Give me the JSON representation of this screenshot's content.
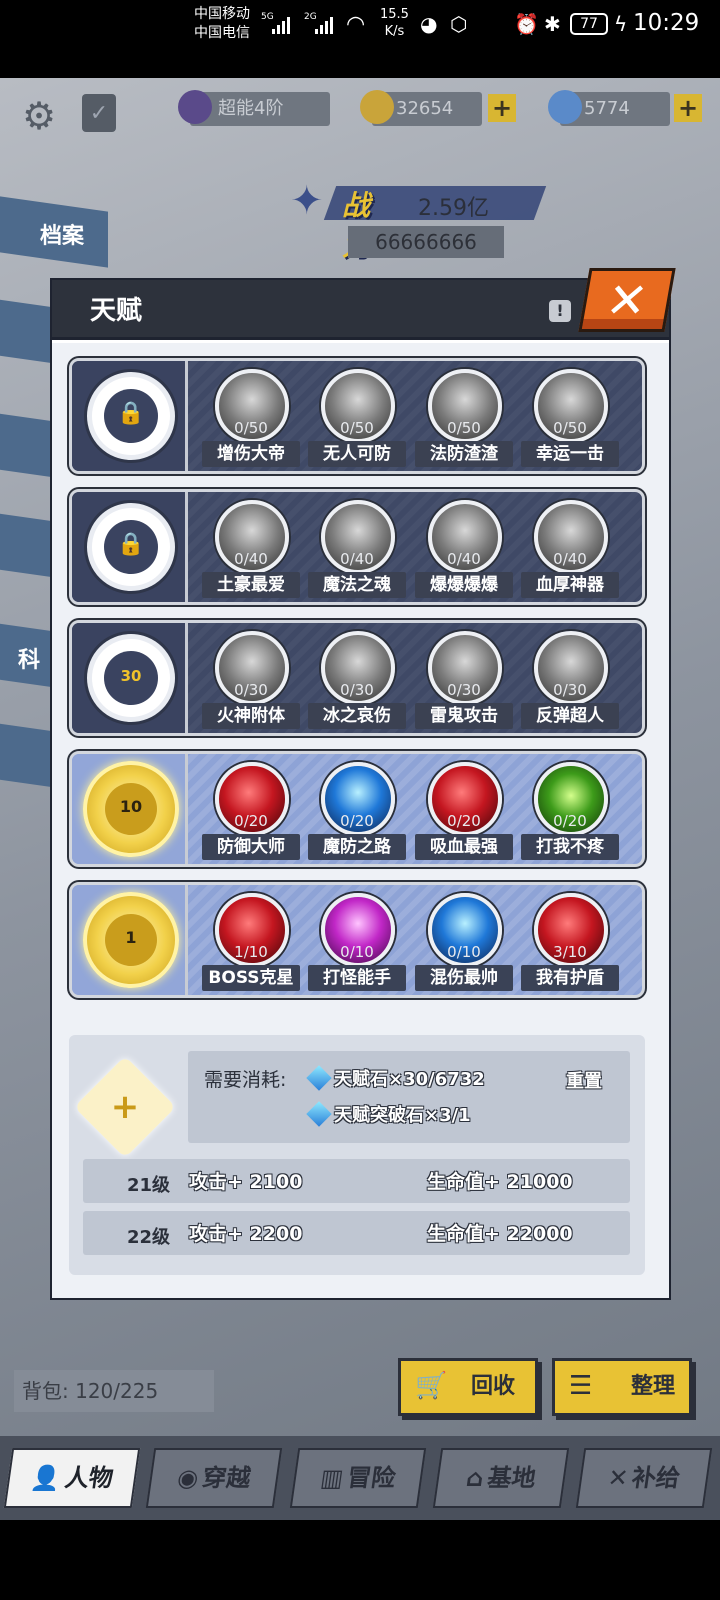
{
  "status_bar": {
    "carrier1": "中国移动",
    "carrier2": "中国电信",
    "net1": "5G",
    "net2": "2G",
    "speed_value": "15.5",
    "speed_unit": "K/s",
    "battery": "77",
    "time": "10:29"
  },
  "top": {
    "rank": "超能4阶",
    "gold": "32654",
    "diamond": "5774"
  },
  "side_tabs": [
    "档案",
    "科"
  ],
  "power": {
    "label": "战力",
    "value": "2.59亿",
    "sub": "66666666"
  },
  "dialog": {
    "title": "天赋",
    "info": "!",
    "close": "✕",
    "rows": [
      {
        "style": "dark",
        "center": "lock",
        "skills": [
          {
            "name": "增伤大帝",
            "count": "0/50",
            "color": "grey"
          },
          {
            "name": "无人可防",
            "count": "0/50",
            "color": "grey"
          },
          {
            "name": "法防渣渣",
            "count": "0/50",
            "color": "grey"
          },
          {
            "name": "幸运一击",
            "count": "0/50",
            "color": "grey"
          }
        ]
      },
      {
        "style": "dark",
        "center": "lock",
        "skills": [
          {
            "name": "土豪最爱",
            "count": "0/40",
            "color": "grey"
          },
          {
            "name": "魔法之魂",
            "count": "0/40",
            "color": "grey"
          },
          {
            "name": "爆爆爆爆",
            "count": "0/40",
            "color": "grey"
          },
          {
            "name": "血厚神器",
            "count": "0/40",
            "color": "grey"
          }
        ]
      },
      {
        "style": "dark",
        "center": "30",
        "skills": [
          {
            "name": "火神附体",
            "count": "0/30",
            "color": "grey"
          },
          {
            "name": "冰之哀伤",
            "count": "0/30",
            "color": "grey"
          },
          {
            "name": "雷鬼攻击",
            "count": "0/30",
            "color": "grey"
          },
          {
            "name": "反弹超人",
            "count": "0/30",
            "color": "grey"
          }
        ]
      },
      {
        "style": "light",
        "center": "10",
        "skills": [
          {
            "name": "防御大师",
            "count": "0/20",
            "color": "r1"
          },
          {
            "name": "魔防之路",
            "count": "0/20",
            "color": "b1"
          },
          {
            "name": "吸血最强",
            "count": "0/20",
            "color": "r1"
          },
          {
            "name": "打我不疼",
            "count": "0/20",
            "color": "g1"
          }
        ]
      },
      {
        "style": "light",
        "center": "1",
        "skills": [
          {
            "name": "BOSS克星",
            "count": "1/10",
            "color": "r1"
          },
          {
            "name": "打怪能手",
            "count": "0/10",
            "color": "p1"
          },
          {
            "name": "混伤最帅",
            "count": "0/10",
            "color": "b1"
          },
          {
            "name": "我有护盾",
            "count": "3/10",
            "color": "r1"
          }
        ]
      }
    ],
    "cost": {
      "label": "需要消耗:",
      "item1": "天赋石×30/6732",
      "item2": "天赋突破石×3/1",
      "reset": "重置",
      "upgrade": "+"
    },
    "levels": [
      {
        "level": "21级",
        "atk": "攻击+ 2100",
        "hp": "生命值+ 21000"
      },
      {
        "level": "22级",
        "atk": "攻击+ 2200",
        "hp": "生命值+ 22000"
      }
    ]
  },
  "bag": "背包: 120/225",
  "actions": {
    "recycle": "回收",
    "organize": "整理"
  },
  "nav": [
    {
      "label": "人物",
      "icon": "person-icon"
    },
    {
      "label": "穿越",
      "icon": "portal-icon"
    },
    {
      "label": "冒险",
      "icon": "map-icon"
    },
    {
      "label": "基地",
      "icon": "home-icon"
    },
    {
      "label": "补给",
      "icon": "tools-icon"
    }
  ]
}
